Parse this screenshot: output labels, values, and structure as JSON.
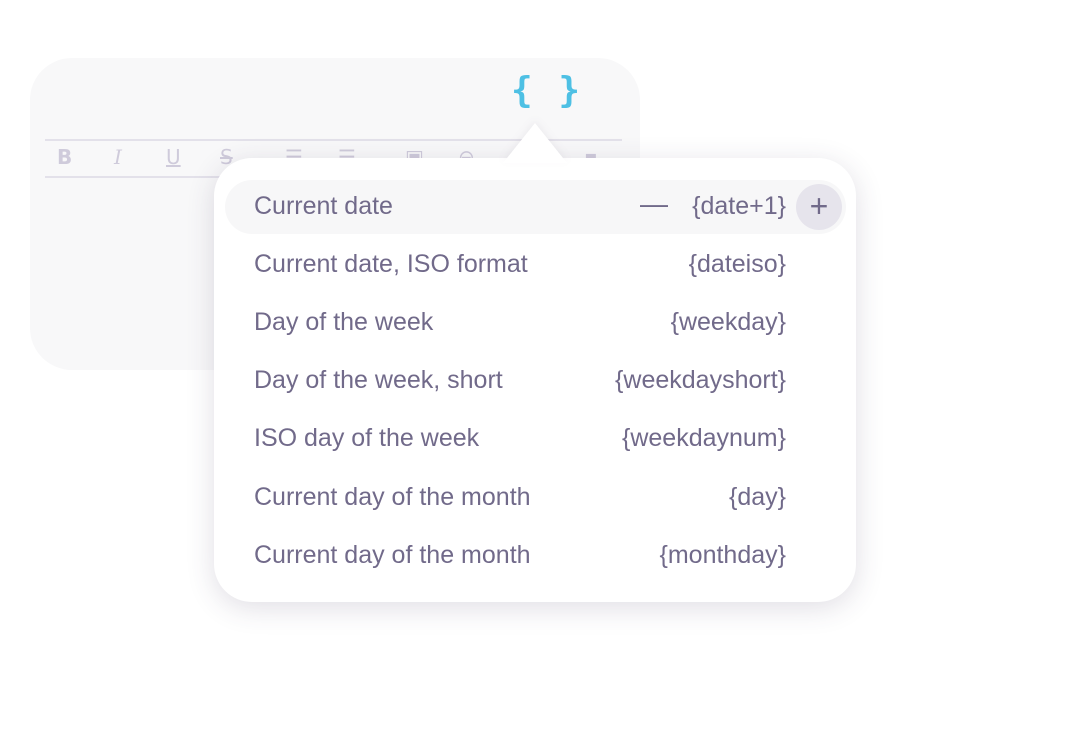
{
  "editor": {
    "variables_button": "{ }",
    "toolbar": [
      {
        "name": "bold",
        "glyph": "B"
      },
      {
        "name": "italic",
        "glyph": "I"
      },
      {
        "name": "underline",
        "glyph": "U"
      },
      {
        "name": "strikethrough",
        "glyph": "S"
      },
      {
        "name": "bullet-list",
        "glyph": "☰"
      },
      {
        "name": "numbered-list",
        "glyph": "☰"
      },
      {
        "name": "image",
        "glyph": "▣"
      },
      {
        "name": "link",
        "glyph": "⊖"
      },
      {
        "name": "blocks",
        "glyph": "▪"
      }
    ]
  },
  "accent_color": "#4ec0e4",
  "text_color": "#716a8a",
  "menu": {
    "items": [
      {
        "label": "Current date",
        "token": "{date+1}",
        "active": true,
        "decrement": "—",
        "increment": "+"
      },
      {
        "label": "Current date, ISO format",
        "token": "{dateiso}"
      },
      {
        "label": "Day of the week",
        "token": "{weekday}"
      },
      {
        "label": "Day of the week, short",
        "token": "{weekdayshort}"
      },
      {
        "label": "ISO day of the week",
        "token": "{weekdaynum}"
      },
      {
        "label": "Current day of the month",
        "token": "{day}"
      },
      {
        "label": "Current day of the month",
        "token": "{monthday}"
      }
    ]
  }
}
